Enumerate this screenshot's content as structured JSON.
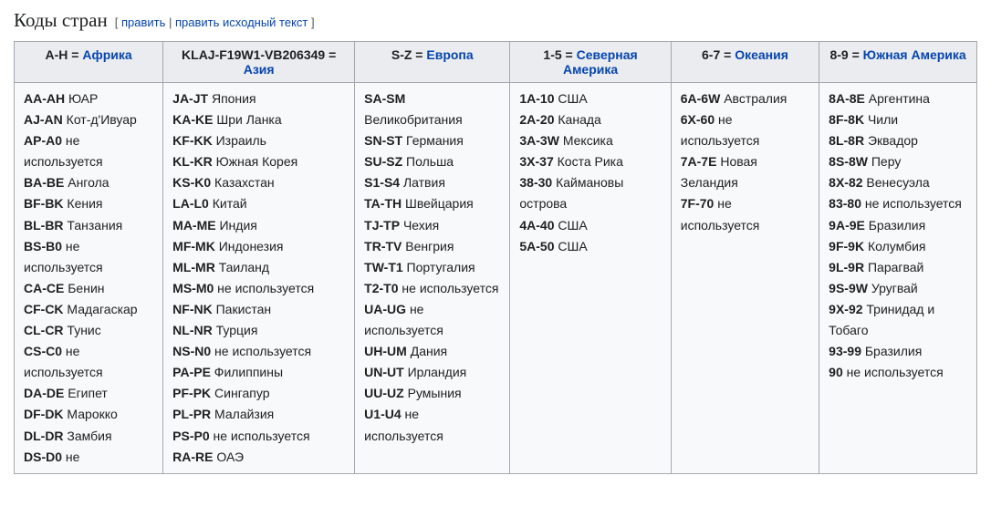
{
  "heading": "Коды стран",
  "editsection": {
    "open": "[",
    "edit": "править",
    "sep": " | ",
    "editsource": "править исходный текст",
    "close": "]"
  },
  "columns": [
    {
      "headerPrefix": "A-H = ",
      "headerLink": "Африка",
      "entries": [
        {
          "code": "AA-AH",
          "label": "ЮАР"
        },
        {
          "code": "AJ-AN",
          "label": "Кот-д'Ивуар"
        },
        {
          "code": "AP-A0",
          "label": "не используется"
        },
        {
          "code": "BA-BE",
          "label": "Ангола"
        },
        {
          "code": "BF-BK",
          "label": "Кения"
        },
        {
          "code": "BL-BR",
          "label": "Танзания"
        },
        {
          "code": "BS-B0",
          "label": "не используется"
        },
        {
          "code": "CA-CE",
          "label": "Бенин"
        },
        {
          "code": "CF-CK",
          "label": "Мадагаскар"
        },
        {
          "code": "CL-CR",
          "label": "Тунис"
        },
        {
          "code": "CS-C0",
          "label": "не используется"
        },
        {
          "code": "DA-DE",
          "label": "Египет"
        },
        {
          "code": "DF-DK",
          "label": "Марокко"
        },
        {
          "code": "DL-DR",
          "label": "Замбия"
        },
        {
          "code": "DS-D0",
          "label": "не"
        }
      ]
    },
    {
      "headerPrefix": "KLAJ-F19W1-VB206349 = ",
      "headerLink": "Азия",
      "entries": [
        {
          "code": "JA-JT",
          "label": "Япония"
        },
        {
          "code": "KA-KE",
          "label": "Шри Ланка"
        },
        {
          "code": "KF-KK",
          "label": "Израиль"
        },
        {
          "code": "KL-KR",
          "label": "Южная Корея"
        },
        {
          "code": "KS-K0",
          "label": "Казахстан"
        },
        {
          "code": "LA-L0",
          "label": "Китай"
        },
        {
          "code": "MA-ME",
          "label": "Индия"
        },
        {
          "code": "MF-MK",
          "label": "Индонезия"
        },
        {
          "code": "ML-MR",
          "label": "Таиланд"
        },
        {
          "code": "MS-M0",
          "label": "не используется"
        },
        {
          "code": "NF-NK",
          "label": "Пакистан"
        },
        {
          "code": "NL-NR",
          "label": "Турция"
        },
        {
          "code": "NS-N0",
          "label": "не используется"
        },
        {
          "code": "PA-PE",
          "label": "Филиппины"
        },
        {
          "code": "PF-PK",
          "label": "Сингапур"
        },
        {
          "code": "PL-PR",
          "label": "Малайзия"
        },
        {
          "code": "PS-P0",
          "label": "не используется"
        },
        {
          "code": "RA-RE",
          "label": "ОАЭ"
        }
      ]
    },
    {
      "headerPrefix": "S-Z = ",
      "headerLink": "Европа",
      "entries": [
        {
          "code": "SA-SM",
          "label": "Великобритания"
        },
        {
          "code": "SN-ST",
          "label": "Германия"
        },
        {
          "code": "SU-SZ",
          "label": "Польша"
        },
        {
          "code": "S1-S4",
          "label": "Латвия"
        },
        {
          "code": "TA-TH",
          "label": "Швейцария"
        },
        {
          "code": "TJ-TP",
          "label": "Чехия"
        },
        {
          "code": "TR-TV",
          "label": "Венгрия"
        },
        {
          "code": "TW-T1",
          "label": "Португалия"
        },
        {
          "code": "T2-T0",
          "label": "не используется"
        },
        {
          "code": "UA-UG",
          "label": "не используется"
        },
        {
          "code": "UH-UM",
          "label": "Дания"
        },
        {
          "code": "UN-UT",
          "label": "Ирландия"
        },
        {
          "code": "UU-UZ",
          "label": "Румыния"
        },
        {
          "code": "U1-U4",
          "label": "не используется"
        }
      ]
    },
    {
      "headerPrefix": "1-5 = ",
      "headerLink": "Северная Америка",
      "entries": [
        {
          "code": "1A-10",
          "label": "США"
        },
        {
          "code": "2A-20",
          "label": "Канада"
        },
        {
          "code": "3A-3W",
          "label": "Мексика"
        },
        {
          "code": "3X-37",
          "label": "Коста Рика"
        },
        {
          "code": "38-30",
          "label": "Каймановы острова"
        },
        {
          "code": "4A-40",
          "label": "США"
        },
        {
          "code": "5A-50",
          "label": "США"
        }
      ]
    },
    {
      "headerPrefix": "6-7 = ",
      "headerLink": "Океания",
      "entries": [
        {
          "code": "6A-6W",
          "label": "Австралия"
        },
        {
          "code": "6X-60",
          "label": "не используется"
        },
        {
          "code": "7A-7E",
          "label": "Новая Зеландия"
        },
        {
          "code": "7F-70",
          "label": "не используется"
        }
      ]
    },
    {
      "headerPrefix": "8-9 = ",
      "headerLink": "Южная Америка",
      "entries": [
        {
          "code": "8A-8E",
          "label": "Аргентина"
        },
        {
          "code": "8F-8K",
          "label": "Чили"
        },
        {
          "code": "8L-8R",
          "label": "Эквадор"
        },
        {
          "code": "8S-8W",
          "label": "Перу"
        },
        {
          "code": "8X-82",
          "label": "Венесуэла"
        },
        {
          "code": "83-80",
          "label": "не используется"
        },
        {
          "code": "9A-9E",
          "label": "Бразилия"
        },
        {
          "code": "9F-9K",
          "label": "Колумбия"
        },
        {
          "code": "9L-9R",
          "label": "Парагвай"
        },
        {
          "code": "9S-9W",
          "label": "Уругвай"
        },
        {
          "code": "9X-92",
          "label": "Тринидад и Тобаго"
        },
        {
          "code": "93-99",
          "label": "Бразилия"
        },
        {
          "code": "90",
          "label": "не используется"
        }
      ]
    }
  ]
}
